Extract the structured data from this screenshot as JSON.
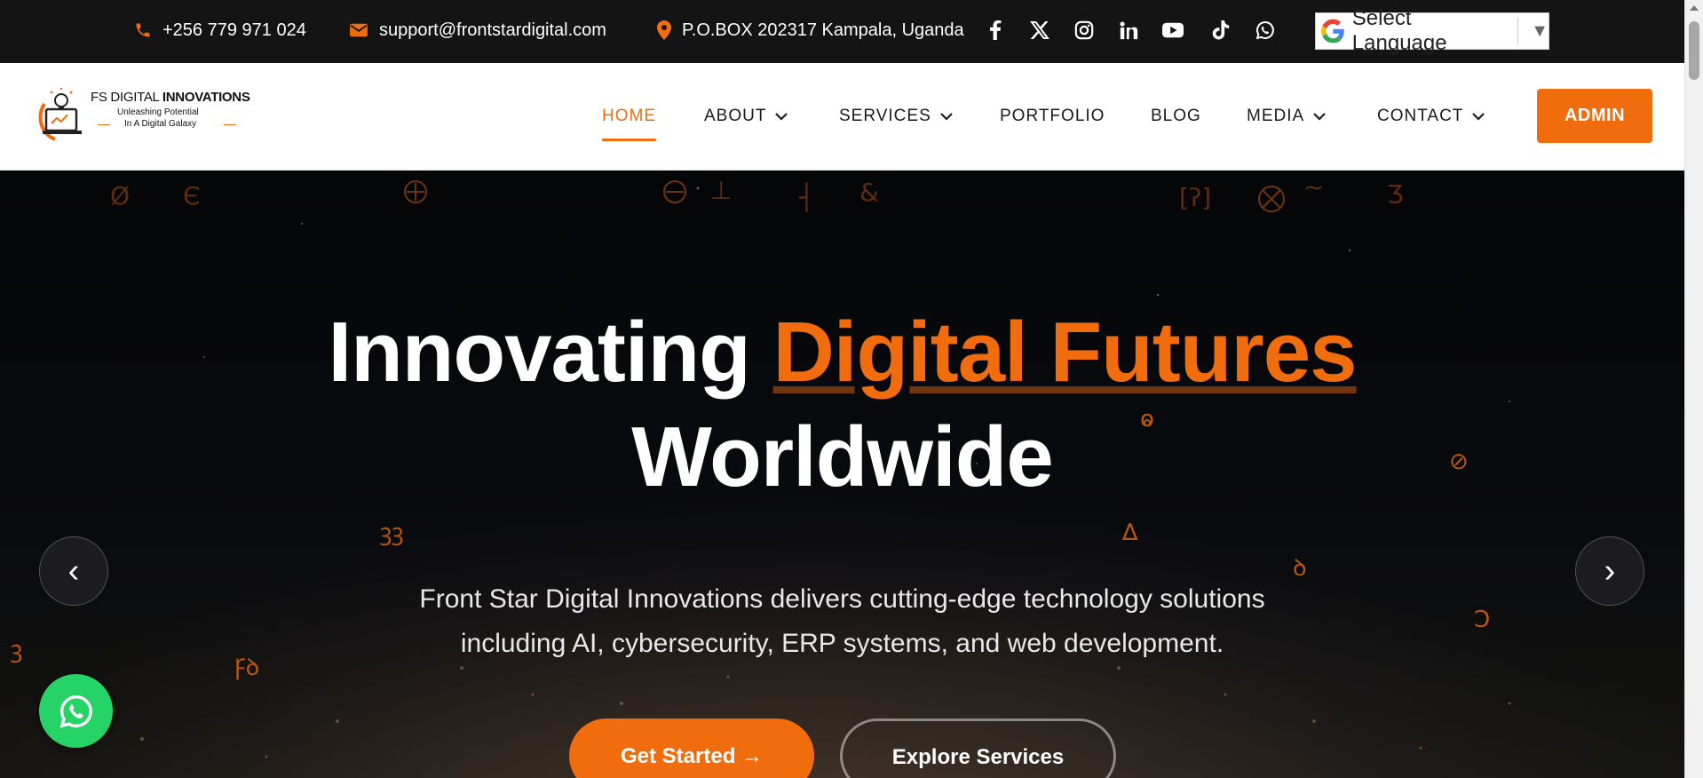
{
  "topbar": {
    "phone": "+256 779 971 024",
    "email": "support@frontstardigital.com",
    "address": "P.O.BOX 202317 Kampala, Uganda",
    "socials": [
      "facebook-icon",
      "x-icon",
      "instagram-icon",
      "linkedin-icon",
      "youtube-icon",
      "tiktok-icon",
      "whatsapp-icon"
    ],
    "language_selector": "Select Language"
  },
  "brand": {
    "name_light": "FS DIGITAL ",
    "name_bold": "INNOVATIONS",
    "tagline_1": "Unleashing Potential",
    "tagline_2": "In A Digital Galaxy",
    "accent_color": "#f06c0d"
  },
  "nav": {
    "items": [
      {
        "label": "HOME",
        "active": true,
        "dropdown": false
      },
      {
        "label": "ABOUT",
        "active": false,
        "dropdown": true
      },
      {
        "label": "SERVICES",
        "active": false,
        "dropdown": true
      },
      {
        "label": "PORTFOLIO",
        "active": false,
        "dropdown": false
      },
      {
        "label": "BLOG",
        "active": false,
        "dropdown": false
      },
      {
        "label": "MEDIA",
        "active": false,
        "dropdown": true
      },
      {
        "label": "CONTACT",
        "active": false,
        "dropdown": true
      }
    ],
    "admin_label": "ADMIN"
  },
  "hero": {
    "title_plain": "Innovating ",
    "title_accent": "Digital Futures",
    "title_line2": "Worldwide",
    "subtitle_line1": "Front Star Digital Innovations delivers cutting-edge technology solutions",
    "subtitle_line2": "including AI, cybersecurity, ERP systems, and web development.",
    "cta_primary": "Get Started →",
    "cta_secondary": "Explore Services",
    "prev_arrow": "‹",
    "next_arrow": "›"
  },
  "floating": {
    "whatsapp_color": "#25d366"
  }
}
